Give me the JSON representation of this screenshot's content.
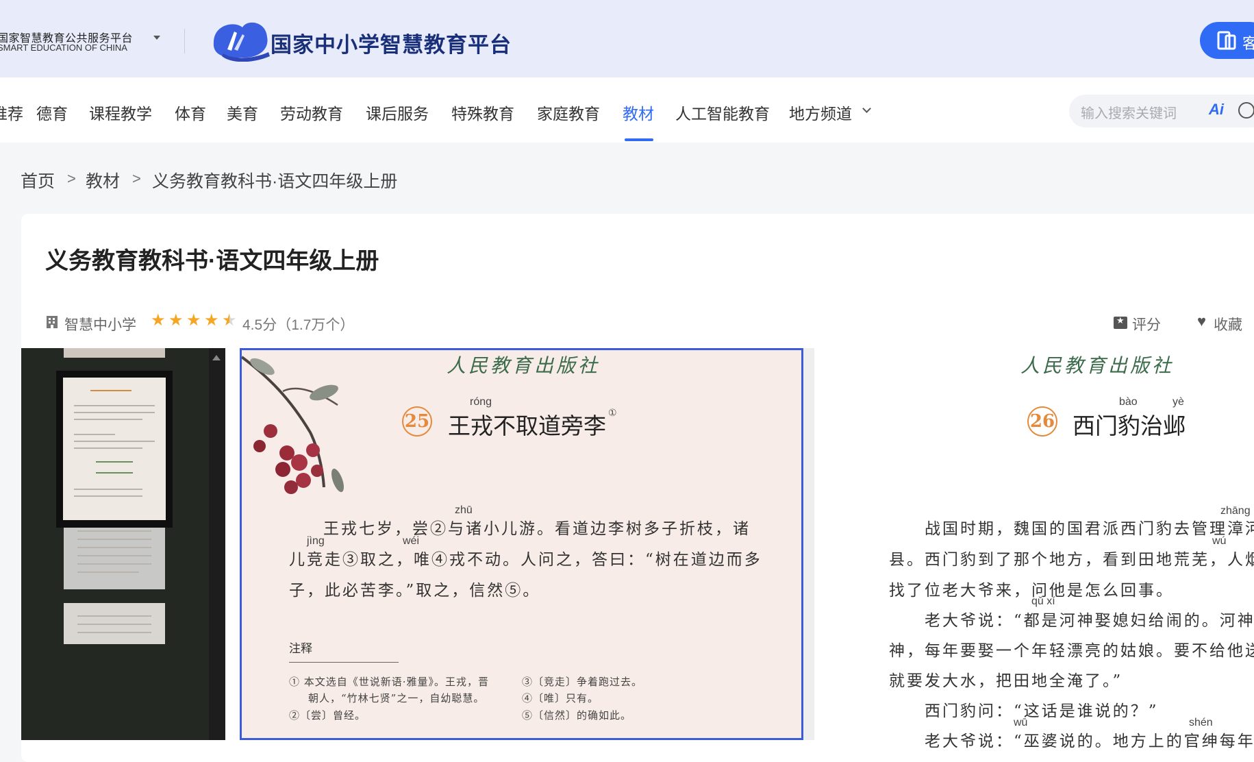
{
  "header": {
    "platform_cn": "国家智慧教育公共服务平台",
    "platform_en": "SMART EDUCATION OF CHINA",
    "brand": "国家中小学智慧教育平台",
    "client_button": "客户端",
    "accent_color": "#2f6bf5"
  },
  "nav": {
    "items": [
      "推荐",
      "德育",
      "课程教学",
      "体育",
      "美育",
      "劳动教育",
      "课后服务",
      "特殊教育",
      "家庭教育",
      "教材",
      "人工智能教育",
      "地方频道"
    ],
    "active": "教材",
    "search_placeholder": "输入搜索关键词",
    "ai_label": "Ai"
  },
  "breadcrumb": {
    "items": [
      "首页",
      "教材",
      "义务教育教科书·语文四年级上册"
    ],
    "separator": ">"
  },
  "book": {
    "title": "义务教育教科书·语文四年级上册",
    "publisher": "智慧中小学",
    "rating": 4.5,
    "score_text": "4.5分（1.7万个）",
    "rate_label": "评分",
    "favorite_label": "收藏"
  },
  "reader": {
    "publisher_script": "人民教育出版社",
    "left_page": {
      "lesson_number": "25",
      "lesson_title": "王戎不取道旁李",
      "title_note": "①",
      "pinyin": {
        "rong": "róng",
        "zhu": "zhū",
        "jing": "jìng",
        "wei": "wéi"
      },
      "lines": [
        "王戎七岁，尝②与诸小儿游。看道边李树多子折枝，诸",
        "儿竞走③取之，唯④戎不动。人问之，答曰：“树在道边而多",
        "子，此必苦李。”取之，信然⑤。"
      ],
      "notes_heading": "注释",
      "notes": [
        "① 本文选自《世说新语·雅量》。王戎，晋",
        "朝人，“竹林七贤”之一，自幼聪慧。",
        "②〔尝〕曾经。",
        "③〔竞走〕争着跑过去。",
        "④〔唯〕只有。",
        "⑤〔信然〕的确如此。"
      ]
    },
    "right_page": {
      "lesson_number": "26",
      "lesson_title": "西门豹治邺",
      "pinyin": {
        "bao": "bào",
        "ye": "yè",
        "zhang": "zhāng",
        "wu": "wú",
        "quxi": "qǔ xí",
        "wu2": "wū",
        "shen": "shén"
      },
      "lines": [
        "战国时期，魏国的国君派西门豹去管理漳河",
        "县。西门豹到了那个地方，看到田地荒芜，人烟",
        "找了位老大爷来，问他是怎么回事。",
        "老大爷说：“都是河神娶媳妇给闹的。河神",
        "神，每年要娶一个年轻漂亮的姑娘。要不给他送",
        "就要发大水，把田地全淹了。”",
        "西门豹问：“这话是谁说的？”",
        "老大爷说：“巫婆说的。地方上的官绅每年出"
      ]
    }
  }
}
